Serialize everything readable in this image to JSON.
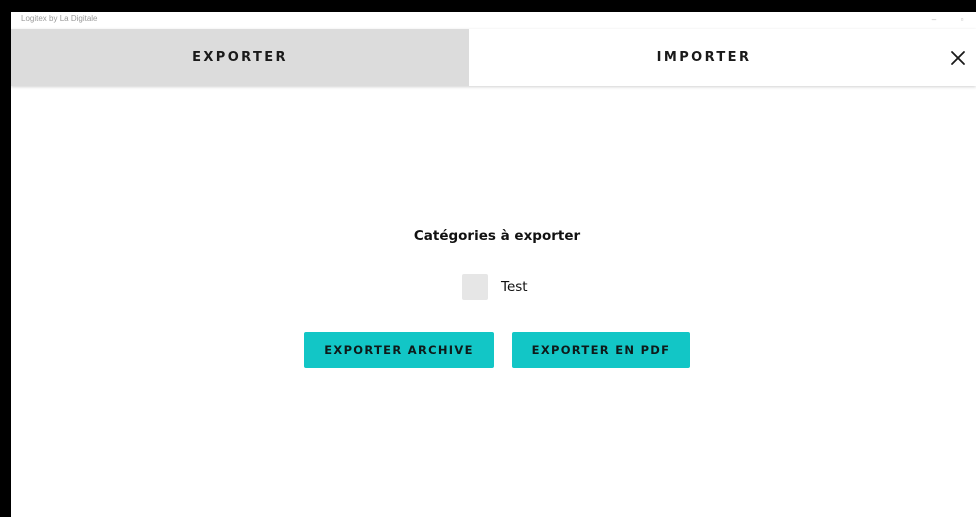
{
  "window": {
    "title": "Logitex by La Digitale"
  },
  "tabs": [
    {
      "label": "EXPORTER",
      "active": true
    },
    {
      "label": "IMPORTER",
      "active": false
    }
  ],
  "close_icon": "close-icon",
  "export": {
    "section_title": "Catégories à exporter",
    "categories": [
      {
        "label": "Test",
        "checked": false
      }
    ],
    "buttons": {
      "archive_label": "EXPORTER ARCHIVE",
      "pdf_label": "EXPORTER EN PDF"
    }
  },
  "colors": {
    "accent": "#12c6c6",
    "active_tab": "#dcdcdc",
    "checkbox": "#e6e6e6",
    "outer_frame": "#000000"
  }
}
